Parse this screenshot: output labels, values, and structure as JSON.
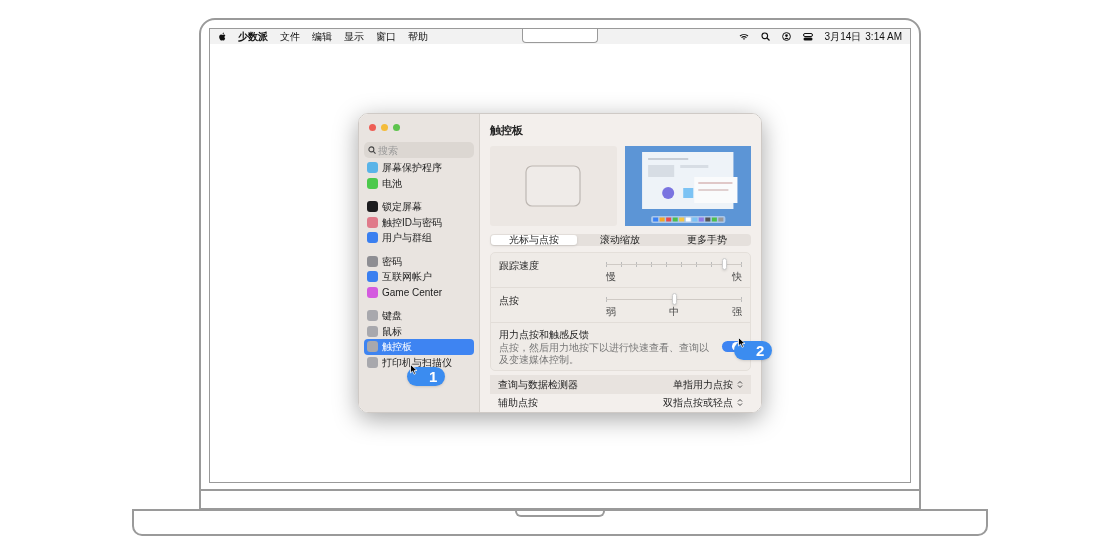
{
  "menu_bar": {
    "app_name": "少数派",
    "menus": [
      "文件",
      "编辑",
      "显示",
      "窗口",
      "帮助"
    ],
    "date": "3月14日",
    "time": "3:14 AM"
  },
  "sidebar": {
    "search": {
      "placeholder": "搜索"
    },
    "groups": [
      [
        {
          "label": "屏幕保护程序",
          "color": "#5ab4e8",
          "selected": false
        },
        {
          "label": "电池",
          "color": "#4cc94c",
          "selected": false
        }
      ],
      [
        {
          "label": "锁定屏幕",
          "color": "#1c1c1e",
          "selected": false
        },
        {
          "label": "触控ID与密码",
          "color": "#e07a8a",
          "selected": false
        },
        {
          "label": "用户与群组",
          "color": "#3a7ff0",
          "selected": false
        }
      ],
      [
        {
          "label": "密码",
          "color": "#8e8e93",
          "selected": false
        },
        {
          "label": "互联网帐户",
          "color": "#3a7ff0",
          "selected": false
        },
        {
          "label": "Game Center",
          "color": "#d45adf",
          "selected": false
        }
      ],
      [
        {
          "label": "键盘",
          "color": "#a8a8ad",
          "selected": false
        },
        {
          "label": "鼠标",
          "color": "#a8a8ad",
          "selected": false
        },
        {
          "label": "触控板",
          "color": "#a8a8ad",
          "selected": true
        },
        {
          "label": "打印机与扫描仪",
          "color": "#a8a8ad",
          "selected": false
        }
      ]
    ]
  },
  "panel": {
    "title": "触控板",
    "tabs": [
      {
        "label": "光标与点按",
        "selected": true
      },
      {
        "label": "滚动缩放",
        "selected": false
      },
      {
        "label": "更多手势",
        "selected": false
      }
    ],
    "sliders": [
      {
        "label": "跟踪速度",
        "level": 0.87,
        "kind": "fine",
        "marks": [
          "慢",
          "快"
        ]
      },
      {
        "label": "点按",
        "level": 0.5,
        "kind": "stepped",
        "marks": [
          "弱",
          "中",
          "强"
        ]
      }
    ],
    "toggle": {
      "label": "用力点按和触感反馈",
      "description": "点按，然后用力地按下以进行快速查看、查询以及变速媒体控制。",
      "on": true
    },
    "popups": [
      {
        "label": "查询与数据检测器",
        "value": "单指用力点按"
      },
      {
        "label": "辅助点按",
        "value": "双指点按或轻点"
      }
    ]
  },
  "callouts": [
    "1",
    "2"
  ]
}
